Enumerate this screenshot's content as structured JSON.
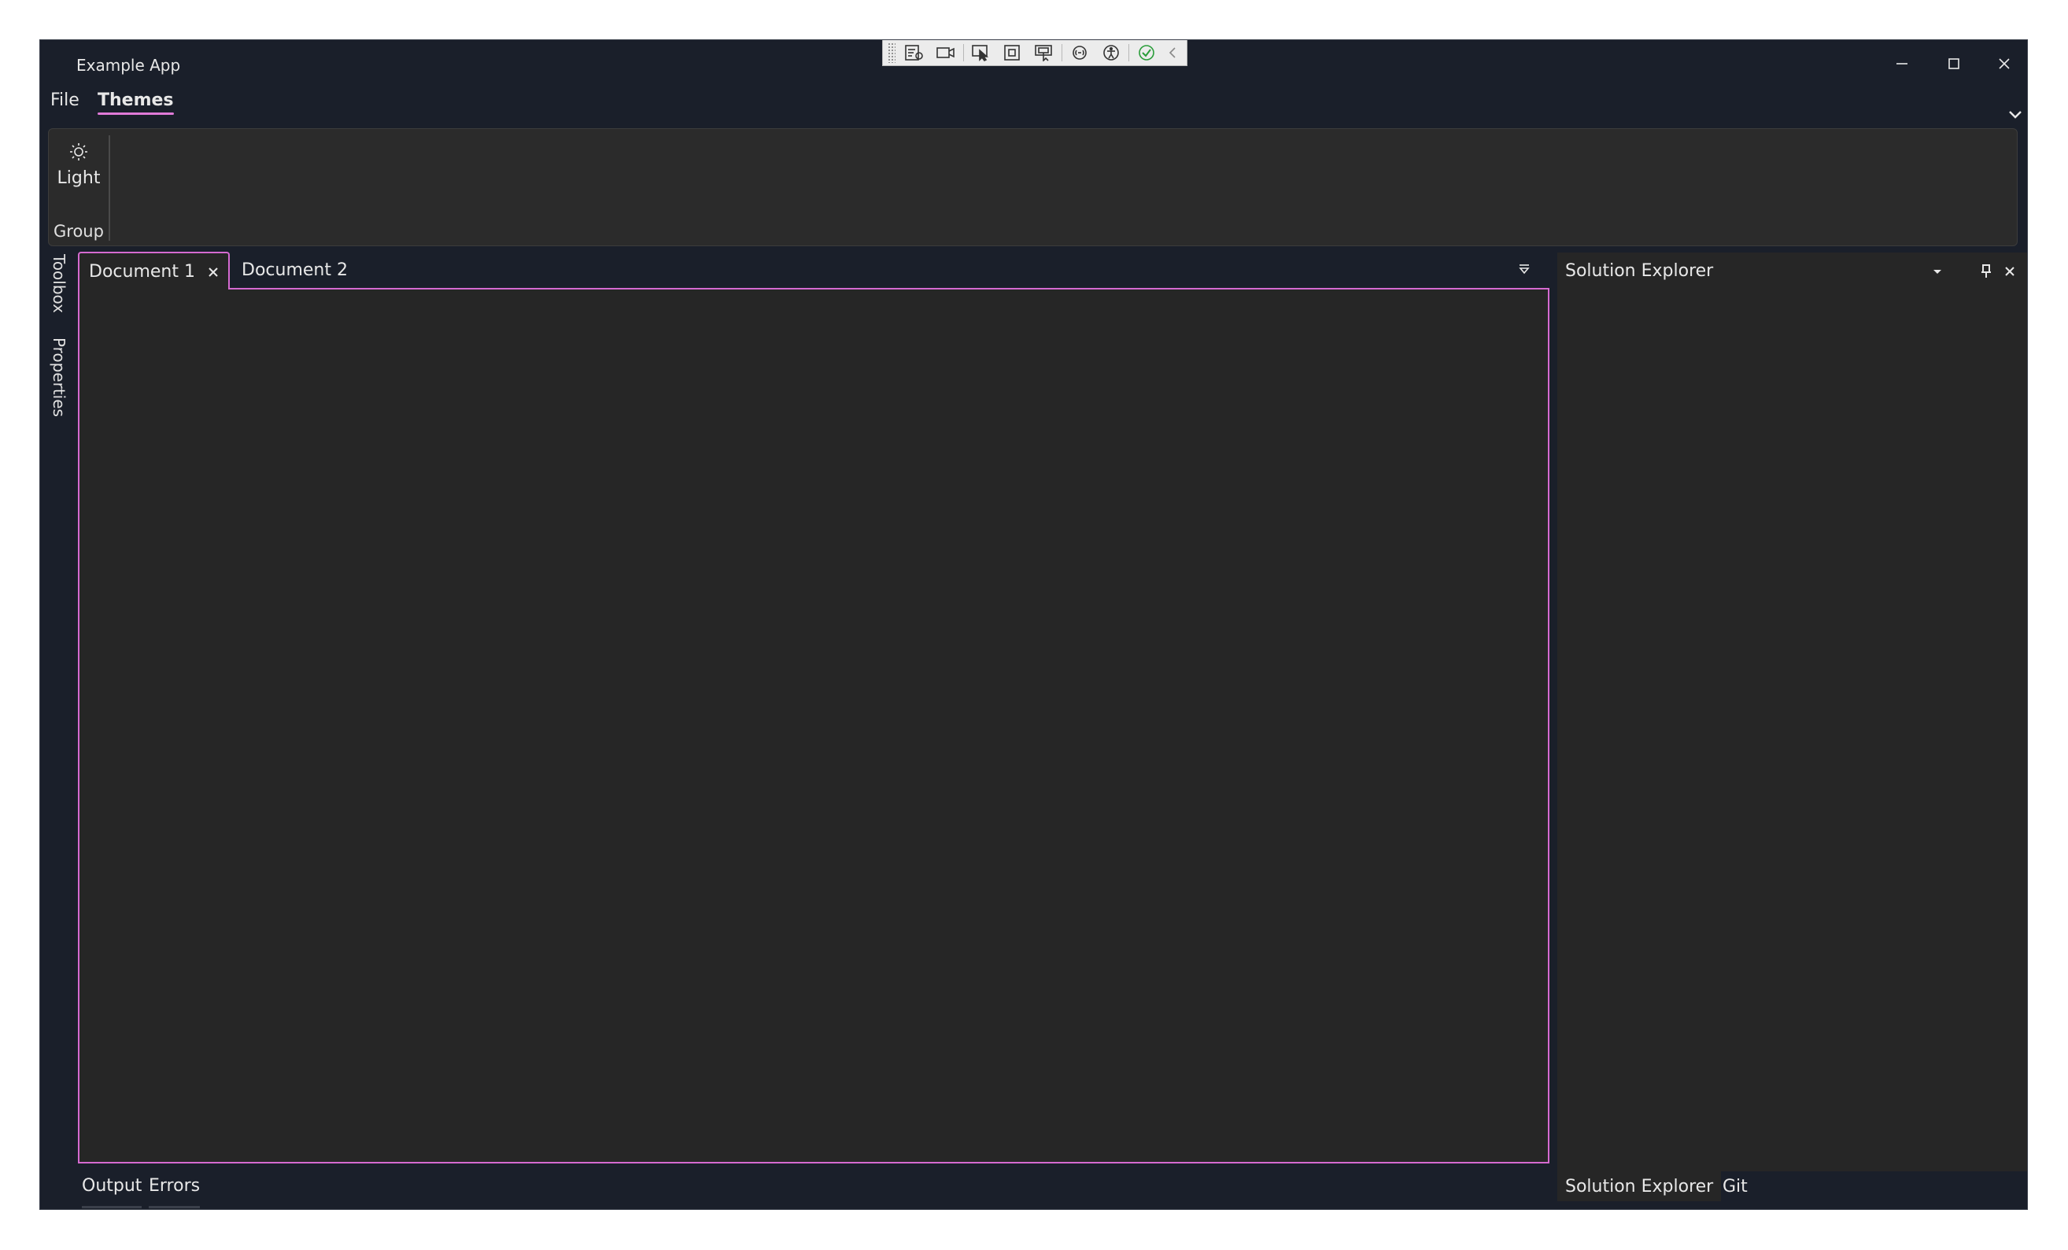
{
  "window": {
    "title": "Example App"
  },
  "title_buttons": {
    "minimize": "minimize",
    "maximize": "maximize",
    "close": "close"
  },
  "debug_toolbar": {
    "icons": [
      "live-visual-tree-icon",
      "record-icon",
      "select-element-icon",
      "display-layout-adorners-icon",
      "track-focus-icon",
      "binding-failures-icon",
      "accessibility-icon",
      "check-icon",
      "collapse-icon"
    ]
  },
  "menu": {
    "file": "File",
    "themes": "Themes"
  },
  "ribbon": {
    "light_label": "Light",
    "group_label": "Group"
  },
  "left_rail": {
    "toolbox": "Toolbox",
    "properties": "Properties"
  },
  "documents": {
    "tab1": "Document 1",
    "tab2": "Document 2"
  },
  "bottom_tabs": {
    "output": "Output",
    "errors": "Errors"
  },
  "solution_explorer": {
    "title": "Solution Explorer",
    "footer_tab1": "Solution Explorer",
    "footer_tab2": "Git"
  },
  "colors": {
    "accent": "#d56ad0",
    "background": "#1a1f2a",
    "panel": "#262626"
  }
}
